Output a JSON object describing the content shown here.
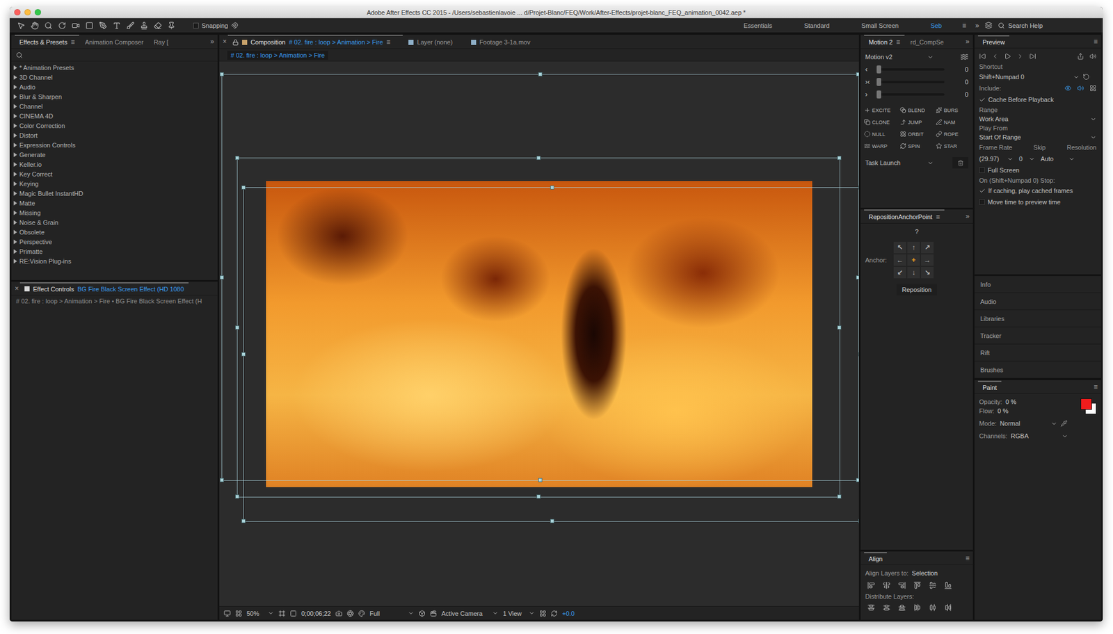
{
  "window": {
    "title": "Adobe After Effects CC 2015 - /Users/sebastienlavoie ... d/Projet-Blanc/FEQ/Work/After-Effects/projet-blanc_FEQ_animation_0042.aep *"
  },
  "toolbar": {
    "snapping": {
      "label": "Snapping",
      "checked": false
    },
    "workspaces": [
      {
        "label": "Essentials",
        "selected": false
      },
      {
        "label": "Standard",
        "selected": false
      },
      {
        "label": "Small Screen",
        "selected": false
      },
      {
        "label": "Seb",
        "selected": true
      }
    ],
    "menu": "≡",
    "more": "»",
    "search": {
      "placeholder": "Search Help"
    }
  },
  "effects_panel": {
    "tabs": [
      {
        "label": "Effects & Presets",
        "selected": true
      },
      {
        "label": "Animation Composer",
        "selected": false
      },
      {
        "label": "Ray [",
        "selected": false
      }
    ],
    "menu": "≡",
    "more": "»",
    "items": [
      {
        "label": "* Animation Presets",
        "expanded": false
      },
      {
        "label": "3D Channel",
        "expanded": false
      },
      {
        "label": "Audio",
        "expanded": false
      },
      {
        "label": "Blur & Sharpen",
        "expanded": false
      },
      {
        "label": "Channel",
        "expanded": false
      },
      {
        "label": "CINEMA 4D",
        "expanded": false
      },
      {
        "label": "Color Correction",
        "expanded": false
      },
      {
        "label": "Distort",
        "expanded": false
      },
      {
        "label": "Expression Controls",
        "expanded": false
      },
      {
        "label": "Generate",
        "expanded": false
      },
      {
        "label": "Keller.io",
        "expanded": false
      },
      {
        "label": "Key Correct",
        "expanded": false
      },
      {
        "label": "Keying",
        "expanded": false
      },
      {
        "label": "Magic Bullet InstantHD",
        "expanded": false
      },
      {
        "label": "Matte",
        "expanded": false
      },
      {
        "label": "Missing",
        "expanded": false
      },
      {
        "label": "Noise & Grain",
        "expanded": false
      },
      {
        "label": "Obsolete",
        "expanded": false
      },
      {
        "label": "Perspective",
        "expanded": false
      },
      {
        "label": "Primatte",
        "expanded": false
      },
      {
        "label": "RE:Vision Plug-ins",
        "expanded": false
      }
    ]
  },
  "effect_controls": {
    "close": "×",
    "title": "Effect Controls",
    "layer": "BG Fire Black Screen Effect (HD 1080",
    "breadcrumb": "# 02. fire : loop > Animation > Fire • BG Fire Black Screen Effect (H"
  },
  "composition": {
    "close": "×",
    "menu": "≡",
    "tabs": [
      {
        "prefix": "Composition",
        "label": "# 02. fire : loop > Animation > Fire",
        "selected": true
      },
      {
        "prefix": "",
        "label": "Layer (none)",
        "selected": false
      },
      {
        "prefix": "",
        "label": "Footage 3-1a.mov",
        "selected": false
      }
    ],
    "breadcrumb": "# 02. fire : loop > Animation > Fire",
    "footer": {
      "zoom": "50%",
      "timecode": "0;00;06;22",
      "resolution": "Full",
      "camera": "Active Camera",
      "views": "1 View",
      "exposure": "+0.0"
    }
  },
  "motion": {
    "tabs": [
      {
        "label": "Motion 2",
        "selected": true
      },
      {
        "label": "rd_CompSe",
        "selected": false
      }
    ],
    "menu": "≡",
    "more": "»",
    "preset": "Motion v2",
    "sliders": [
      {
        "icon": "‹",
        "level": 0,
        "value": "0"
      },
      {
        "icon": "›‹",
        "level": 0,
        "value": "0"
      },
      {
        "icon": "›",
        "level": 0,
        "value": "0"
      }
    ],
    "buttons": [
      "EXCITE",
      "BLEND",
      "BURS",
      "CLONE",
      "JUMP",
      "NAM",
      "NULL",
      "ORBIT",
      "ROPE",
      "WARP",
      "SPIN",
      "STAR"
    ],
    "task_launch": "Task Launch"
  },
  "reposition": {
    "title": "RepositionAnchorPoint",
    "menu": "≡",
    "more": "»",
    "help": "?",
    "anchor_label": "Anchor:",
    "anchors": [
      {
        "glyph": "↖",
        "selected": false
      },
      {
        "glyph": "↑",
        "selected": false
      },
      {
        "glyph": "↗",
        "selected": false
      },
      {
        "glyph": "←",
        "selected": false
      },
      {
        "glyph": "+",
        "selected": true
      },
      {
        "glyph": "→",
        "selected": false
      },
      {
        "glyph": "↙",
        "selected": false
      },
      {
        "glyph": "↓",
        "selected": false
      },
      {
        "glyph": "↘",
        "selected": false
      }
    ],
    "button": "Reposition"
  },
  "align": {
    "title": "Align",
    "menu": "≡",
    "align_to_label": "Align Layers to:",
    "align_to": "Selection",
    "distribute_label": "Distribute Layers:"
  },
  "preview": {
    "title": "Preview",
    "menu": "≡",
    "shortcut_label": "Shortcut",
    "shortcut": "Shift+Numpad 0",
    "include_label": "Include:",
    "cache": {
      "label": "Cache Before Playback",
      "checked": true
    },
    "range_label": "Range",
    "range": "Work Area",
    "play_from_label": "Play From",
    "play_from": "Start Of Range",
    "frame_rate_label": "Frame Rate",
    "skip_label": "Skip",
    "resolution_label": "Resolution",
    "frame_rate": "(29.97)",
    "skip": "0",
    "resolution": "Auto",
    "full_screen": {
      "label": "Full Screen",
      "checked": false
    },
    "stop_label": "On (Shift+Numpad 0) Stop:",
    "stop_options": [
      {
        "label": "If caching, play cached frames",
        "checked": true
      },
      {
        "label": "Move time to preview time",
        "checked": false
      }
    ]
  },
  "collapsed_panels": [
    "Info",
    "Audio",
    "Libraries",
    "Tracker",
    "Rift",
    "Brushes"
  ],
  "paint": {
    "title": "Paint",
    "menu": "≡",
    "opacity_label": "Opacity:",
    "opacity": "0 %",
    "flow_label": "Flow:",
    "flow": "0 %",
    "mode_label": "Mode:",
    "mode": "Normal",
    "channels_label": "Channels:",
    "channels": "RGBA",
    "swatches": [
      {
        "name": "foreground",
        "color": "#f01c1c"
      },
      {
        "name": "background",
        "color": "#ffffff"
      }
    ]
  }
}
